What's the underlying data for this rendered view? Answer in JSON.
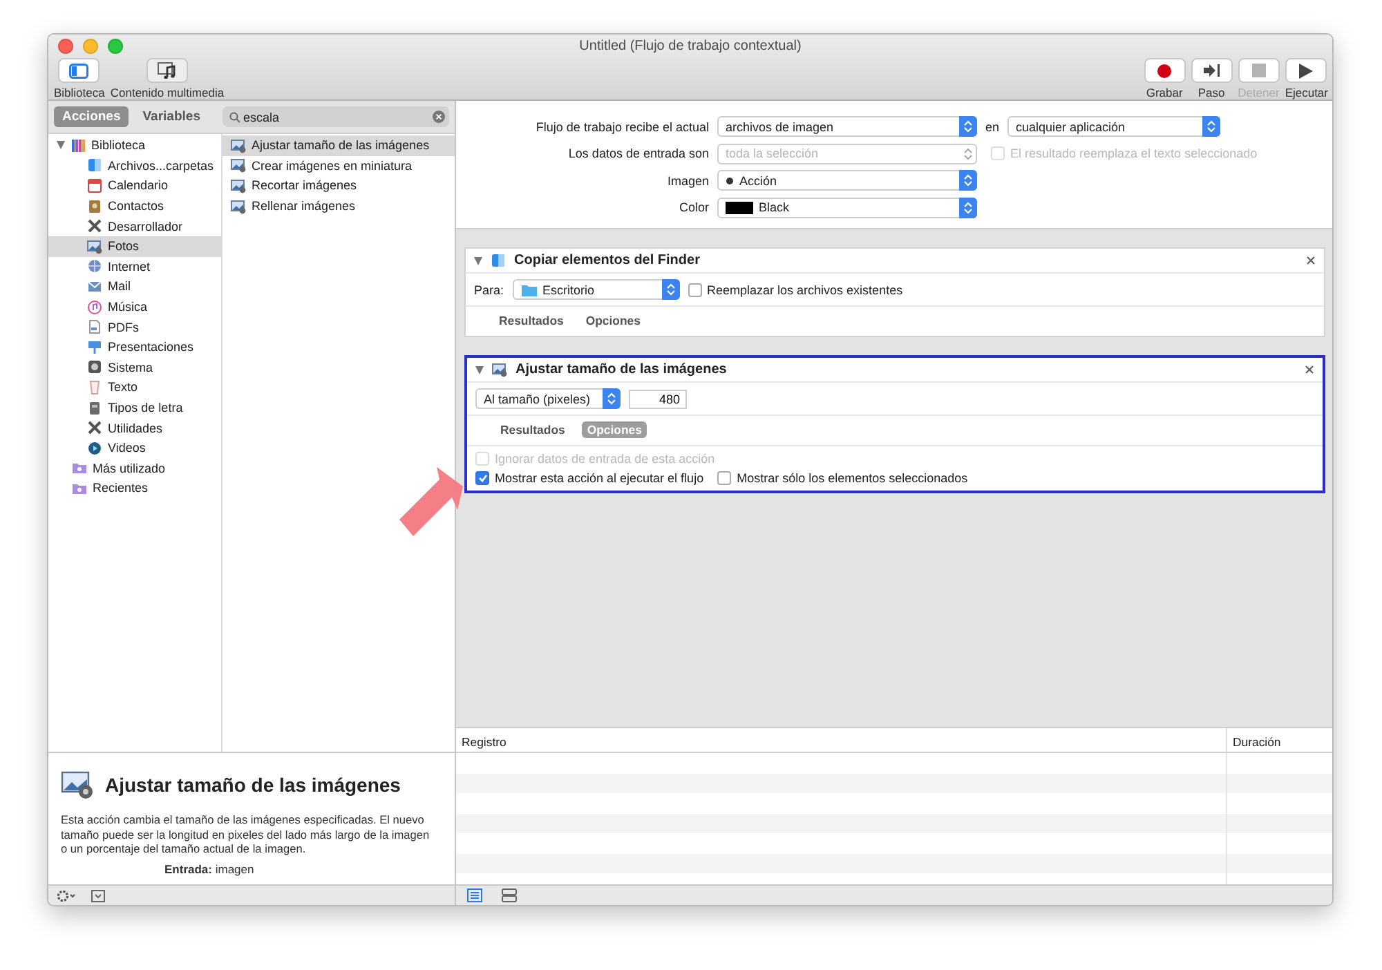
{
  "window": {
    "title": "Untitled (Flujo de trabajo contextual)"
  },
  "toolbar_left": [
    {
      "label": "Biblioteca",
      "kind": "library",
      "selected": true
    },
    {
      "label": "Contenido multimedia",
      "kind": "media",
      "selected": false
    }
  ],
  "toolbar_right": [
    {
      "label": "Grabar",
      "kind": "record",
      "disabled": false
    },
    {
      "label": "Paso",
      "kind": "step",
      "disabled": false
    },
    {
      "label": "Detener",
      "kind": "stop",
      "disabled": true
    },
    {
      "label": "Ejecutar",
      "kind": "run",
      "disabled": false
    }
  ],
  "library_tabs": [
    {
      "label": "Acciones",
      "selected": true
    },
    {
      "label": "Variables",
      "selected": false
    }
  ],
  "search": {
    "value": "escala"
  },
  "library": [
    {
      "label": "Biblioteca",
      "kind": "library",
      "expanded": true,
      "selected": false,
      "children": [
        {
          "label": "Archivos...carpetas",
          "kind": "finder",
          "selected": false
        },
        {
          "label": "Calendario",
          "kind": "calendar",
          "selected": false
        },
        {
          "label": "Contactos",
          "kind": "contacts",
          "selected": false
        },
        {
          "label": "Desarrollador",
          "kind": "tools",
          "selected": false
        },
        {
          "label": "Fotos",
          "kind": "photos",
          "selected": true
        },
        {
          "label": "Internet",
          "kind": "globe",
          "selected": false
        },
        {
          "label": "Mail",
          "kind": "mail",
          "selected": false
        },
        {
          "label": "Música",
          "kind": "music",
          "selected": false
        },
        {
          "label": "PDFs",
          "kind": "pdf",
          "selected": false
        },
        {
          "label": "Presentaciones",
          "kind": "presentation",
          "selected": false
        },
        {
          "label": "Sistema",
          "kind": "system",
          "selected": false
        },
        {
          "label": "Texto",
          "kind": "text",
          "selected": false
        },
        {
          "label": "Tipos de letra",
          "kind": "fonts",
          "selected": false
        },
        {
          "label": "Utilidades",
          "kind": "tools",
          "selected": false
        },
        {
          "label": "Videos",
          "kind": "video",
          "selected": false
        }
      ]
    },
    {
      "label": "Más utilizado",
      "kind": "smart-folder",
      "selected": false
    },
    {
      "label": "Recientes",
      "kind": "smart-folder",
      "selected": false
    }
  ],
  "actions": [
    {
      "label": "Ajustar tamaño de las imágenes",
      "selected": true
    },
    {
      "label": "Crear imágenes en miniatura",
      "selected": false
    },
    {
      "label": "Recortar imágenes",
      "selected": false
    },
    {
      "label": "Rellenar imágenes",
      "selected": false
    }
  ],
  "description": {
    "title": "Ajustar tamaño de las imágenes",
    "body": "Esta acción cambia el tamaño de las imágenes especificadas. El nuevo tamaño puede ser la longitud en pixeles del lado más largo de la imagen o un porcentaje del tamaño actual de la imagen.",
    "input": "**Entrada:** imagen"
  },
  "workflow_settings": {
    "receives_label": "Flujo de trabajo recibe el actual",
    "receives_value": "archivos de imagen",
    "in_label": "en",
    "in_value": "cualquier aplicación",
    "input_label": "Los datos de entrada son",
    "input_value": "toda la selección",
    "input_disabled": true,
    "replace": {
      "label": "El resultado reemplaza el texto seleccionado",
      "checked": false,
      "disabled": true
    },
    "image_label": "Imagen",
    "image_value": "Acción",
    "color_label": "Color",
    "color_value": "Black",
    "color": "#000000"
  },
  "workflow_actions": [
    {
      "kind": "copy",
      "title": "Copiar elementos del Finder",
      "selected": false,
      "expanded": true,
      "to_label": "Para:",
      "to_value": "Escritorio",
      "options": [
        {
          "label": "Reemplazar los archivos existentes",
          "checked": false,
          "disabled": false
        }
      ],
      "tabs": [
        {
          "label": "Resultados",
          "selected": false
        },
        {
          "label": "Opciones",
          "selected": false
        }
      ]
    },
    {
      "kind": "resize",
      "title": "Ajustar tamaño de las imágenes",
      "selected": true,
      "expanded": true,
      "mode_value": "Al tamaño (pixeles)",
      "size_value": "480",
      "tabs": [
        {
          "label": "Resultados",
          "selected": false
        },
        {
          "label": "Opciones",
          "selected": true
        }
      ],
      "options": [
        {
          "label": "Ignorar datos de entrada de esta acción",
          "checked": false,
          "disabled": true
        },
        {
          "label": "Mostrar esta acción al ejecutar el flujo",
          "checked": true,
          "disabled": false
        },
        {
          "label": "Mostrar sólo los elementos seleccionados",
          "checked": false,
          "disabled": false
        }
      ]
    }
  ],
  "log": {
    "columns": [
      "Registro",
      "Duración"
    ]
  }
}
